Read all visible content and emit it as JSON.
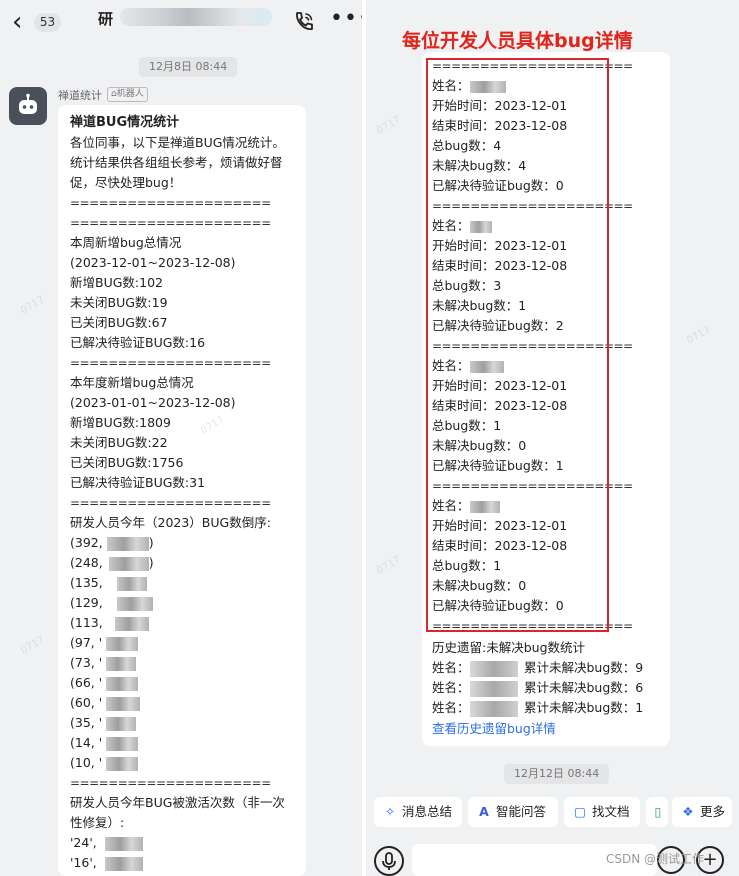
{
  "left": {
    "unread_count": "53",
    "chat_title": "研",
    "date_pill": "12月8日 08:44",
    "sender": "禅道统计",
    "bot_tag": "机器人",
    "message": {
      "title": "禅道BUG情况统计",
      "intro": "各位同事，以下是禅道BUG情况统计。统计结果供各组组长参考，烦请做好督促，尽快处理bug！",
      "separator": "=====================",
      "weekly": [
        "本周新增bug总情况",
        "(2023-12-01~2023-12-08)",
        "新增BUG数:102",
        "未关闭BUG数:19",
        "已关闭BUG数:67",
        "已解决待验证BUG数:16"
      ],
      "yearly": [
        "本年度新增bug总情况",
        "(2023-01-01~2023-12-08)",
        "新增BUG数:1809",
        "未关闭BUG数:22",
        "已关闭BUG数:1756",
        "已解决待验证BUG数:31"
      ],
      "ranking_title": "研发人员今年（2023）BUG数倒序:",
      "ranking": [
        "(392,",
        "(248,",
        "(135,",
        "(129,",
        "(113,",
        "(97, '",
        "(73, '",
        "(66, '",
        "(60, '",
        "(35, '",
        "(14, '",
        "(10, '"
      ],
      "ranking_close_1": ")",
      "ranking_close_2": ")",
      "reactivation_title": "研发人员今年BUG被激活次数（非一次性修复）:",
      "reactivation": [
        "'24',",
        "'16',"
      ]
    }
  },
  "right": {
    "annotation": "每位开发人员具体bug详情",
    "separator": "=====================",
    "labels": {
      "name": "姓名：",
      "start": "开始时间：",
      "end": "结束时间：",
      "total": "总bug数：",
      "unresolved": "未解决bug数：",
      "pending": "已解决待验证bug数："
    },
    "developers": [
      {
        "start": "2023-12-01",
        "end": "2023-12-08",
        "total": "4",
        "unresolved": "4",
        "pending": "0"
      },
      {
        "start": "2023-12-01",
        "end": "2023-12-08",
        "total": "3",
        "unresolved": "1",
        "pending": "2"
      },
      {
        "start": "2023-12-01",
        "end": "2023-12-08",
        "total": "1",
        "unresolved": "0",
        "pending": "1"
      },
      {
        "start": "2023-12-01",
        "end": "2023-12-08",
        "total": "1",
        "unresolved": "0",
        "pending": "0"
      }
    ],
    "history": {
      "title": "历史遗留:未解决bug数统计",
      "name_label": "姓名：",
      "count_label": "累计未解决bug数：",
      "rows": [
        "9",
        "6",
        "1"
      ],
      "link": "查看历史遗留bug详情"
    },
    "date_pill": "12月12日 08:44",
    "actions": [
      {
        "icon": "sparkle-icon",
        "label": "消息总结"
      },
      {
        "icon": "ai-icon",
        "label": "智能问答"
      },
      {
        "icon": "doc-search-icon",
        "label": "找文档"
      },
      {
        "icon": "doc-icon",
        "label": ""
      },
      {
        "icon": "apps-icon",
        "label": "更多"
      }
    ],
    "watermark": "CSDN @测试工作"
  },
  "colors": {
    "annotation": "#e0241b",
    "red_box": "#d9262b",
    "link": "#2b6fe6",
    "background": "#f0f1f3"
  }
}
